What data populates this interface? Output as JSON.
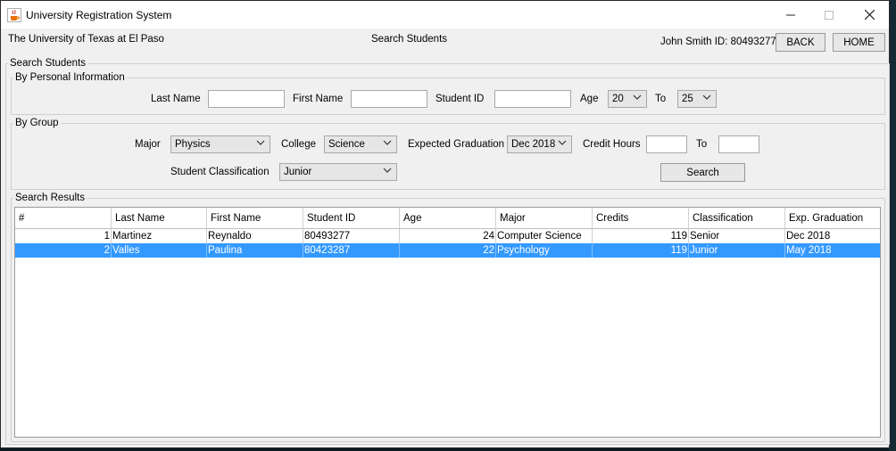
{
  "window": {
    "title": "University Registration System",
    "min_icon": "minimize-icon",
    "max_icon": "maximize-icon",
    "close_icon": "close-icon",
    "app_icon": "java-cup-icon"
  },
  "header": {
    "university": "The University of Texas at El Paso",
    "page_title": "Search Students",
    "user": "John Smith ID: 80493277",
    "back": "BACK",
    "home": "HOME"
  },
  "search": {
    "legend": "Search Students",
    "personal": {
      "legend": "By Personal Information",
      "last_name_label": "Last Name",
      "last_name": "",
      "first_name_label": "First Name",
      "first_name": "",
      "student_id_label": "Student ID",
      "student_id": "",
      "age_label": "Age",
      "age_from": "20",
      "to_label": "To",
      "age_to": "25"
    },
    "group": {
      "legend": "By Group",
      "major_label": "Major",
      "major": "Physics",
      "college_label": "College",
      "college": "Science",
      "expected_label": "Expected Graduation",
      "expected": "Dec 2018",
      "credit_label": "Credit Hours",
      "credit_from": "",
      "to_label": "To",
      "credit_to": "",
      "class_label": "Student Classification",
      "classification": "Junior",
      "search_btn": "Search"
    }
  },
  "results": {
    "legend": "Search Results",
    "columns": [
      "#",
      "Last Name",
      "First Name",
      "Student ID",
      "Age",
      "Major",
      "Credits",
      "Classification",
      "Exp. Graduation"
    ],
    "rows": [
      [
        "1",
        "Martinez",
        "Reynaldo",
        "80493277",
        "24",
        "Computer Science",
        "119",
        "Senior",
        "Dec 2018"
      ],
      [
        "2",
        "Valles",
        "Paulina",
        "80423287",
        "22",
        "Psychology",
        "119",
        "Junior",
        "May 2018"
      ]
    ],
    "selected_row": 2
  }
}
